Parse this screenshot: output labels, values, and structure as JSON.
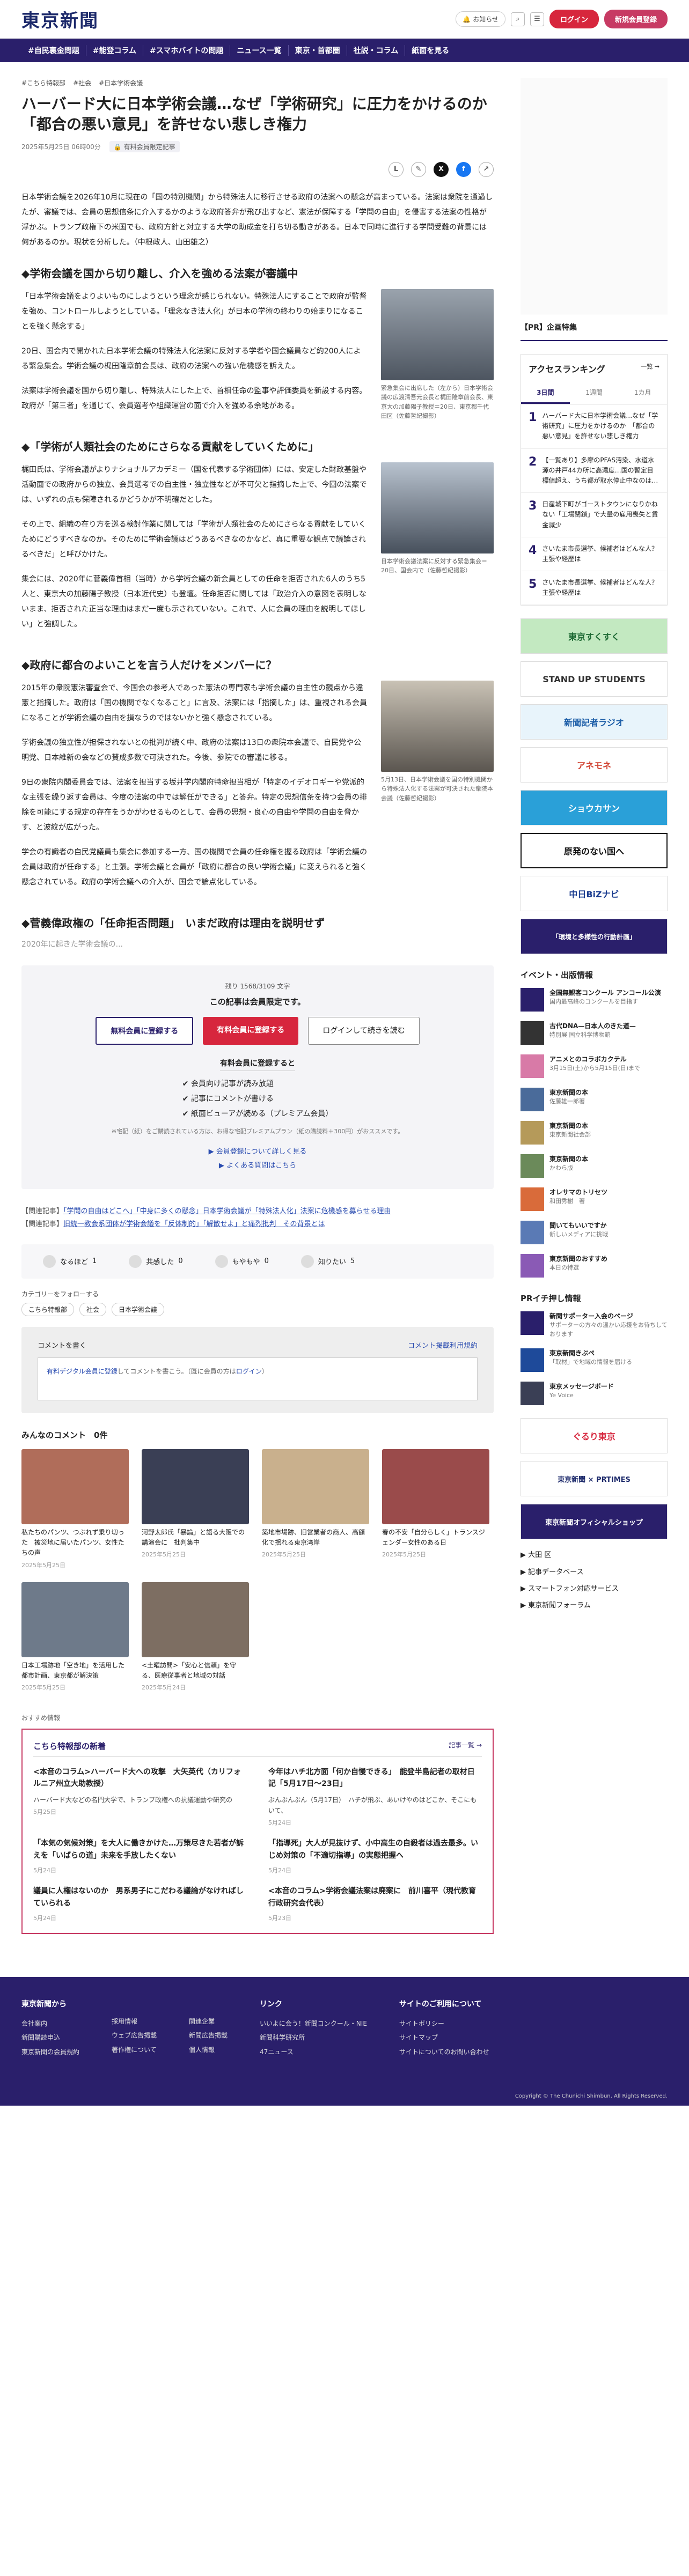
{
  "header": {
    "logo": "東京新聞",
    "notice": "お知らせ",
    "login": "ログイン",
    "register": "新規会員登録"
  },
  "nav": [
    "#自民裏金問題",
    "#能登コラム",
    "#スマホバイトの問題",
    "ニュース一覧",
    "東京・首都圏",
    "社説・コラム",
    "紙面を見る"
  ],
  "article": {
    "tags": [
      "#こちら特報部",
      "#社会",
      "#日本学術会議"
    ],
    "title": "ハーバード大に日本学術会議…なぜ「学術研究」に圧力をかけるのか　「都合の悪い意見」を許せない悲しき権力",
    "date": "2025年5月25日 06時00分",
    "badge": "有料会員限定記事",
    "lead": "日本学術会議を2026年10月に現在の「国の特別機関」から特殊法人に移行させる政府の法案への懸念が高まっている。法案は衆院を通過したが、審議では、会員の思想信条に介入するかのような政府答弁が飛び出すなど、憲法が保障する「学問の自由」を侵害する法案の性格が浮かぶ。トランプ政権下の米国でも、政府方針と対立する大学の助成金を打ち切る動きがある。日本で同時に進行する学問受難の背景には何があるのか。現状を分析した。（中根政人、山田雄之）",
    "s1": "学術会議を国から切り離し、介入を強める法案が審議中",
    "s1p1": "「日本学術会議をよりよいものにしようという理念が感じられない。特殊法人にすることで政府が監督を強め、コントロールしようとしている。「理念なき法人化」が日本の学術の終わりの始まりになることを強く懸念する」",
    "s1p2": "20日、国会内で開かれた日本学術会議の特殊法人化法案に反対する学者や国会議員など約200人による緊急集会。学術会議の梶田隆章前会長は、政府の法案への強い危機感を訴えた。",
    "s1p3": "法案は学術会議を国から切り離し、特殊法人にした上で、首相任命の監事や評価委員を新設する内容。政府が「第三者」を通じて、会員選考や組織運営の面で介入を強める余地がある。",
    "s1cap": "緊急集会に出席した（左から）日本学術会議の広渡清吾元会長と梶田隆章前会長、東京大の加藤陽子教授＝20日、東京都千代田区（佐藤哲紀撮影）",
    "s2": "「学術が人類社会のためにさらなる貢献をしていくために」",
    "s2p1": "梶田氏は、学術会議がよりナショナルアカデミー（国を代表する学術団体）には、安定した財政基盤や活動面での政府からの独立、会員選考での自主性・独立性などが不可欠と指摘した上で、今回の法案では、いずれの点も保障されるかどうかが不明確だとした。",
    "s2p2": "その上で、組織の在り方を巡る検討作業に関しては「学術が人類社会のためにさらなる貢献をしていくためにどうすべきなのか。そのために学術会議はどうあるべきなのかなど、真に重要な観点で議論されるべきだ」と呼びかけた。",
    "s2p3": "集会には、2020年に菅義偉首相（当時）から学術会議の新会員としての任命を拒否された6人のうち5人と、東京大の加藤陽子教授（日本近代史）も登壇。任命拒否に関しては「政治介入の意図を表明しないまま、拒否された正当な理由はまだ一度も示されていない。これで、人に会員の理由を説明してほしい」と強調した。",
    "s2cap": "日本学術会議法案に反対する緊急集会＝20日、国会内で（佐藤哲紀撮影）",
    "s3": "政府に都合のよいことを言う人だけをメンバーに？",
    "s3p1": "2015年の衆院憲法審査会で、今国会の参考人であった憲法の専門家も学術会議の自主性の観点から違憲と指摘した。政府は「国の機関でなくなること」に言及、法案には「指摘した」は、重視される会員になることが学術会議の自由を損なうのではないかと強く懸念されている。",
    "s3p2": "学術会議の独立性が担保されないとの批判が続く中、政府の法案は13日の衆院本会議で、自民党や公明党、日本維新の会などの賛成多数で可決された。今後、参院での審議に移る。",
    "s3p3": "9日の衆院内閣委員会では、法案を担当する坂井学内閣府特命担当相が「特定のイデオロギーや党派的な主張を繰り返す会員は、今度の法案の中では解任ができる」と答弁。特定の思想信条を持つ会員の排除を可能にする規定の存在をうかがわせるものとして、会員の思想・良心の自由や学問の自由を脅かす、と波紋が広がった。",
    "s3p4": "学会の有識者の自民党議員も集会に参加する一方、国の機関で会員の任命権を握る政府は「学術会議の会員は政府が任命する」と主張。学術会議と会員が「政府に都合の良い学術会議」に変えられると強く懸念されている。政府の学術会議への介入が、国会で論点化している。",
    "s3cap": "5月13日、日本学術会議を国の特別機関から特殊法人化する法案が可決された衆院本会議（佐藤哲紀撮影）",
    "s4": "菅義偉政権の「任命拒否問題」　いまだ政府は理由を説明せず",
    "fade": "2020年に起きた学術会議の..."
  },
  "paywall": {
    "remain": "残り 1568/3109 文字",
    "title": "この記事は会員限定です。",
    "free": "無料会員に登録する",
    "paid": "有料会員に登録する",
    "login": "ログインして続きを読む",
    "sub": "有料会員に登録すると",
    "benefits": [
      "会員向け記事が読み放題",
      "記事にコメントが書ける",
      "紙面ビューアが読める（プレミアム会員）"
    ],
    "note": "※宅配（紙）をご購読されている方は、お得な宅配プレミアムプラン（紙の購読料＋300円）がおススメです。",
    "link1": "会員登録について詳しく見る",
    "link2": "よくある質問はこちら"
  },
  "related": {
    "label1": "【関連記事】",
    "text1": "「学問の自由はどこへ」「中身に多くの懸念」日本学術会議が「特殊法人化」法案に危機感を募らせる理由",
    "label2": "【関連記事】",
    "text2": "旧統一教会系団体が学術会議を「反体制的」「解散せよ」と痛烈批判　その背景とは"
  },
  "reactions": [
    {
      "label": "なるほど",
      "count": "1"
    },
    {
      "label": "共感した",
      "count": "0"
    },
    {
      "label": "もやもや",
      "count": "0"
    },
    {
      "label": "知りたい",
      "count": "5"
    }
  ],
  "follow": {
    "title": "カテゴリーをフォローする",
    "tags": [
      "こちら特報部",
      "社会",
      "日本学術会議"
    ]
  },
  "comment": {
    "title": "コメントを書く",
    "policy": "コメント掲載利用規約",
    "prompt": "有料デジタル会員に登録",
    "prompt2": "してコメントを書こう。（既に会員の方は",
    "login": "ログイン",
    "prompt3": "）"
  },
  "mincom": "みんなのコメント　0件",
  "mgrid": [
    {
      "t": "私たちのパンツ、つぶれず乗り切った　被災地に届いたパンツ、女性たちの声",
      "d": "2025年5月25日"
    },
    {
      "t": "河野太郎氏「暴論」と語る大阪での講演会に　批判集中",
      "d": "2025年5月25日"
    },
    {
      "t": "築地市場跡、旧営業者の商人、高額化で揺れる東京湾岸",
      "d": "2025年5月25日"
    },
    {
      "t": "春の不安「自分らしく」トランスジェンダー女性のある日",
      "d": "2025年5月25日"
    },
    {
      "t": "日本工場跡地「空き地」を活用した都市計画、東京都が解決策",
      "d": "2025年5月25日"
    },
    {
      "t": "<土曜訪問>「安心と信頼」を守る、医療従事者と地域の対話",
      "d": "2025年5月24日"
    }
  ],
  "recommend": "おすすめ情報",
  "special": {
    "title": "こちら特報部の新着",
    "more": "記事一覧 →",
    "items": [
      {
        "t": "<本音のコラム>ハーバード大への攻撃　大矢英代（カリフォルニア州立大助教授）",
        "b": "ハーバード大などの名門大学で、トランプ政権への抗議運動や研究の",
        "d": "5月25日"
      },
      {
        "t": "今年はハチ北方面「何か自慢できる」　能登半島記者の取材日記「5月17日〜23日」",
        "b": "ぶんぶんぶん（5月17日）　ハチが飛ぶ、あいけやのはどこか、そこにもいて、",
        "d": "5月24日"
      },
      {
        "t": "「本気の気候対策」を大人に働きかけた…万策尽きた若者が訴えを「いばらの道」未来を手放したくない",
        "d": "5月24日"
      },
      {
        "t": "「指導死」大人が見抜けず、小中高生の自殺者は過去最多。いじめ対策の「不適切指導」の実態把握へ",
        "d": "5月24日"
      },
      {
        "t": "議員に人権はないのか　男系男子にこだわる議論がなければしていられる",
        "d": "5月24日"
      },
      {
        "t": "<本音のコラム>学術会議法案は廃案に　前川喜平（現代教育行政研究会代表）",
        "d": "5月23日"
      }
    ]
  },
  "side": {
    "pr": "【PR】企画特集",
    "ranking": "アクセスランキング",
    "ranking_more": "一覧 →",
    "tabs": [
      "3日間",
      "1週間",
      "1カ月"
    ],
    "ranks": [
      "ハーバード大に日本学術会議…なぜ「学術研究」に圧力をかけるのか　「都合の悪い意見」を許せない悲しき権力",
      "【一覧あり】多摩のPFAS汚染、水道水源の井戸44カ所に高濃度…国の暫定目標値超え、うち都が取水停止中なのは…",
      "日産城下町がゴーストタウンになりかねない「工場閉鎖」で大量の雇用喪失と賃金減少",
      "さいたま市長選挙、候補者はどんな人？主張や経歴は",
      "さいたま市長選挙、候補者はどんな人？主張や経歴は"
    ],
    "banners": [
      "東京すくすく",
      "STAND UP STUDENTS",
      "新聞記者ラジオ",
      "アネモネ",
      "ショウカサン",
      "原発のない国へ",
      "中日BiZナビ",
      "「環境と多様性の行動計画」"
    ],
    "ev_title": "イベント・出版情報",
    "events": [
      {
        "t": "全国無観客コンクール アンコール公演",
        "s": "国内最高峰のコンクールを目指す"
      },
      {
        "t": "古代DNA—日本人のきた道—",
        "s": "特別展 国立科学博物館"
      },
      {
        "t": "アニメとのコラボカクテル",
        "s": "3月15日(土)から5月15日(日)まで"
      },
      {
        "t": "東京新聞の本",
        "s": "佐藤雄一郎著"
      },
      {
        "t": "東京新聞の本",
        "s": "東京新聞社会部"
      },
      {
        "t": "東京新聞の本",
        "s": "かわら版"
      },
      {
        "t": "オレサマのトリセツ",
        "s": "和田秀樹　著"
      },
      {
        "t": "聞いてもいいですか",
        "s": "新しいメディアに挑戦"
      },
      {
        "t": "東京新聞のおすすめ",
        "s": "本日の特選"
      }
    ],
    "pr_title": "PRイチ押し情報",
    "pr_items": [
      {
        "t": "新聞サポーター入会のページ",
        "s": "サポーターの方々の温かい応援をお待ちしております"
      },
      {
        "t": "東京新聞きぷぺ",
        "s": "「取材」で地域の情報を届ける"
      },
      {
        "t": "東京メッセージボード",
        "s": "Ye Voice"
      }
    ],
    "pr2_banners": [
      "ぐるり東京",
      "東京新聞 × PRTIMES",
      "東京新聞オフィシャルショップ"
    ],
    "links": [
      "大田 区",
      "記事データベース",
      "スマートフォン対応サービス",
      "東京新聞フォーラム"
    ]
  },
  "footer": {
    "c1_title": "東京新聞から",
    "c1": [
      "会社案内",
      "新聞購読申込",
      "東京新聞の会員規約"
    ],
    "c2_title": "",
    "c2": [
      "採用情報",
      "ウェブ広告掲載",
      "著作権について"
    ],
    "c3_title": "",
    "c3": [
      "関連企業",
      "新聞広告掲載",
      "個人情報"
    ],
    "c4_title": "リンク",
    "c4": [
      "いいよに会う！新聞コンクール・NIE",
      "新聞科学研究所",
      "47ニュース"
    ],
    "c5_title": "サイトのご利用について",
    "c5": [
      "サイトポリシー",
      "サイトマップ",
      "サイトについてのお問い合わせ"
    ],
    "copy": "Copyright © The Chunichi Shimbun, All Rights Reserved."
  }
}
